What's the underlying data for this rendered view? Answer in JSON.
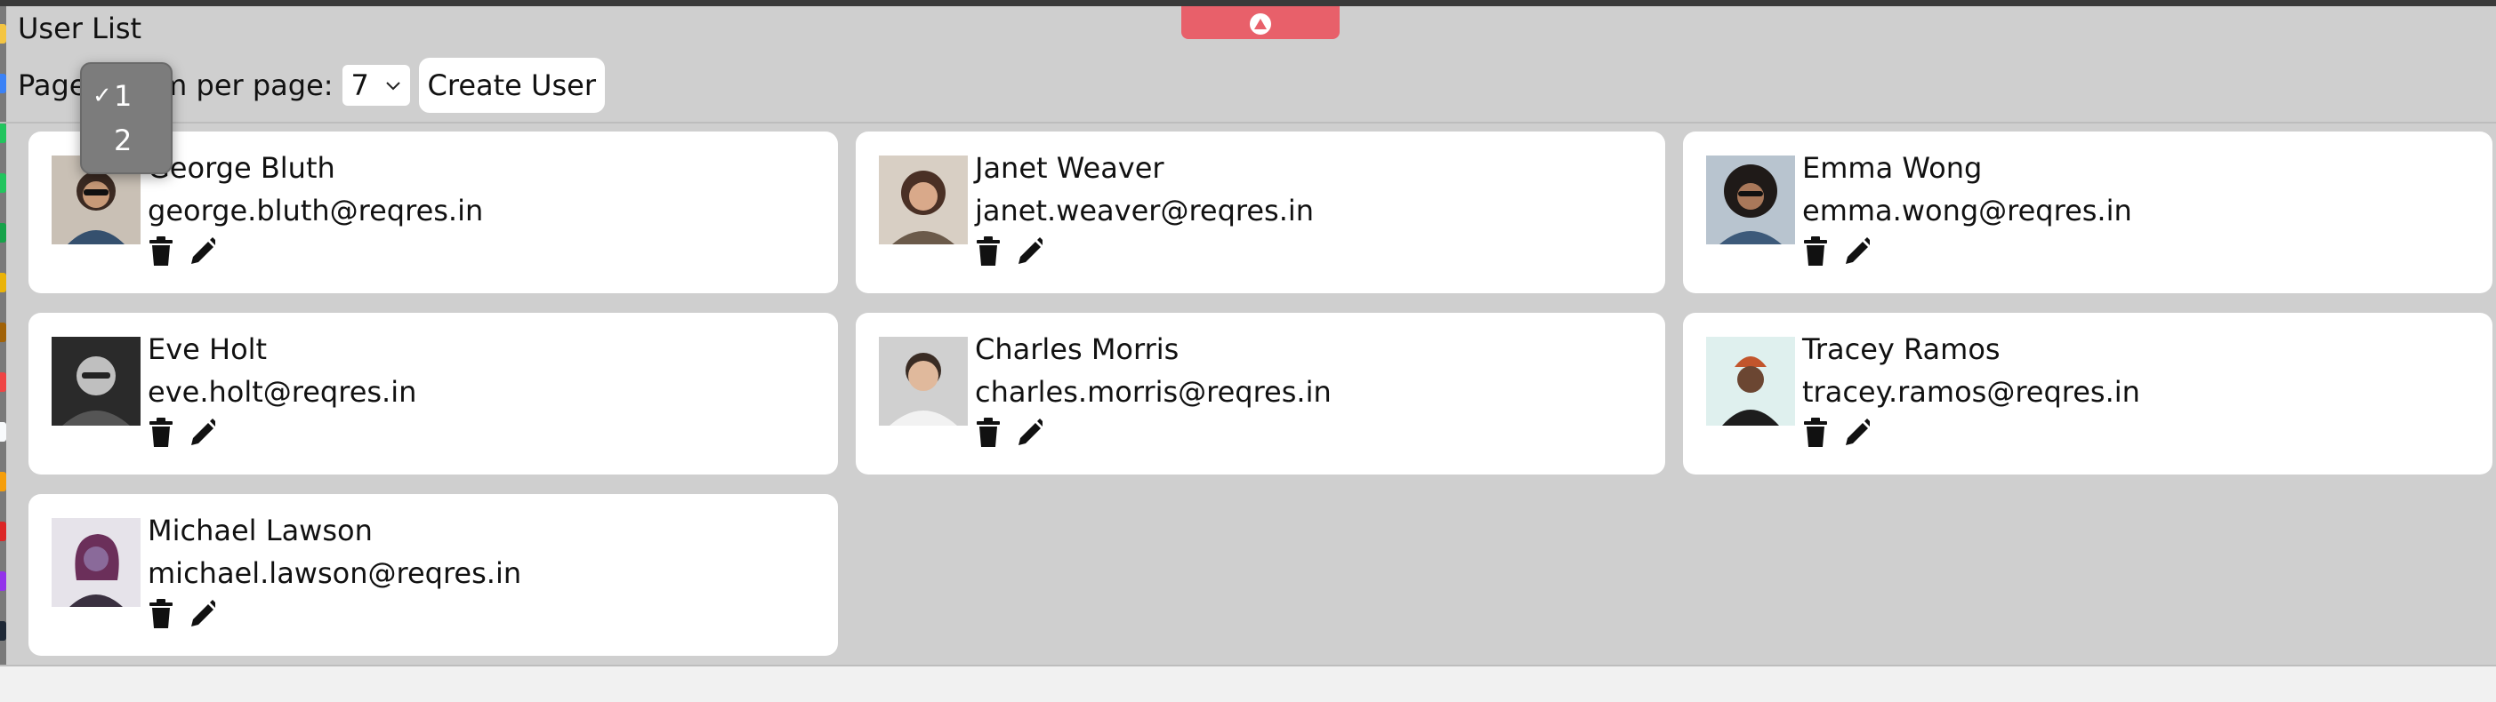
{
  "page": {
    "title": "User List"
  },
  "controls": {
    "page_label": "Page",
    "per_page_label": "em per page:",
    "per_page_value": "7",
    "create_button": "Create User"
  },
  "page_dropdown": {
    "options": [
      {
        "label": "1",
        "checked": true,
        "check": "✓"
      },
      {
        "label": "2",
        "checked": false,
        "check": ""
      }
    ]
  },
  "users": [
    {
      "name": "George Bluth",
      "email": "george.bluth@reqres.in",
      "avatar": "avatar-photo"
    },
    {
      "name": "Janet Weaver",
      "email": "janet.weaver@reqres.in",
      "avatar": "avatar-photo"
    },
    {
      "name": "Emma Wong",
      "email": "emma.wong@reqres.in",
      "avatar": "avatar-photo"
    },
    {
      "name": "Eve Holt",
      "email": "eve.holt@reqres.in",
      "avatar": "avatar-photo"
    },
    {
      "name": "Charles Morris",
      "email": "charles.morris@reqres.in",
      "avatar": "avatar-photo"
    },
    {
      "name": "Tracey Ramos",
      "email": "tracey.ramos@reqres.in",
      "avatar": "avatar-photo"
    },
    {
      "name": "Michael Lawson",
      "email": "michael.lawson@reqres.in",
      "avatar": "avatar-photo"
    }
  ],
  "icons": {
    "delete": "trash-icon",
    "edit": "pencil-icon"
  },
  "colors": {
    "background": "#cfcfcf",
    "card": "#ffffff",
    "accent_pill": "#e8606a"
  }
}
